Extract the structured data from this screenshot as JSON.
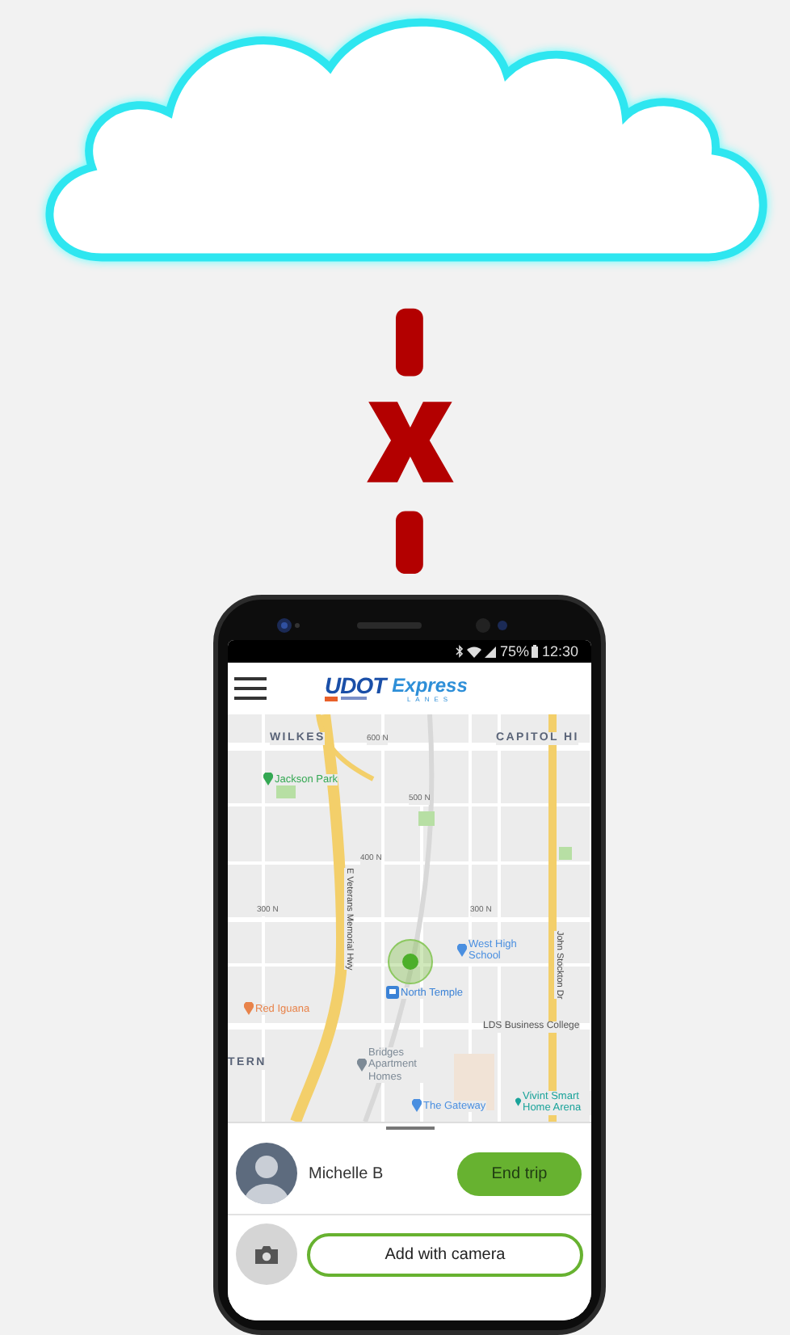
{
  "status_bar": {
    "battery": "75%",
    "time": "12:30"
  },
  "header": {
    "logo_primary": "UDOT",
    "logo_secondary": "Express",
    "logo_secondary_sub": "LANES"
  },
  "map": {
    "labels": [
      {
        "kind": "area",
        "text": "WILKES"
      },
      {
        "kind": "street",
        "text": "600 N"
      },
      {
        "kind": "area",
        "text": "CAPITOL HI"
      },
      {
        "kind": "place",
        "text": "Jackson Park",
        "color": "#34a853"
      },
      {
        "kind": "street",
        "text": "500 N"
      },
      {
        "kind": "street",
        "text": "400 N"
      },
      {
        "kind": "street",
        "text": "300 N"
      },
      {
        "kind": "street",
        "text": "300 N"
      },
      {
        "kind": "road",
        "text": "E Veterans Memorial Hwy"
      },
      {
        "kind": "road",
        "text": "John Stockton Dr"
      },
      {
        "kind": "place",
        "text": "West High School",
        "color": "#4a8fe0"
      },
      {
        "kind": "transit",
        "text": "North Temple",
        "color": "#3b82d6"
      },
      {
        "kind": "place",
        "text": "Red Iguana",
        "color": "#e8834a"
      },
      {
        "kind": "plain",
        "text": "LDS Business College"
      },
      {
        "kind": "area",
        "text": "TERN"
      },
      {
        "kind": "place",
        "text": "Bridges Apartment Homes",
        "color": "#7d8a96"
      },
      {
        "kind": "place",
        "text": "The Gateway",
        "color": "#4a8fe0"
      },
      {
        "kind": "place",
        "text": "Vivint Smart Home Arena",
        "color": "#1aa39a"
      }
    ]
  },
  "trip": {
    "driver": "Michelle B",
    "end_button": "End trip"
  },
  "camera": {
    "button": "Add with camera"
  }
}
